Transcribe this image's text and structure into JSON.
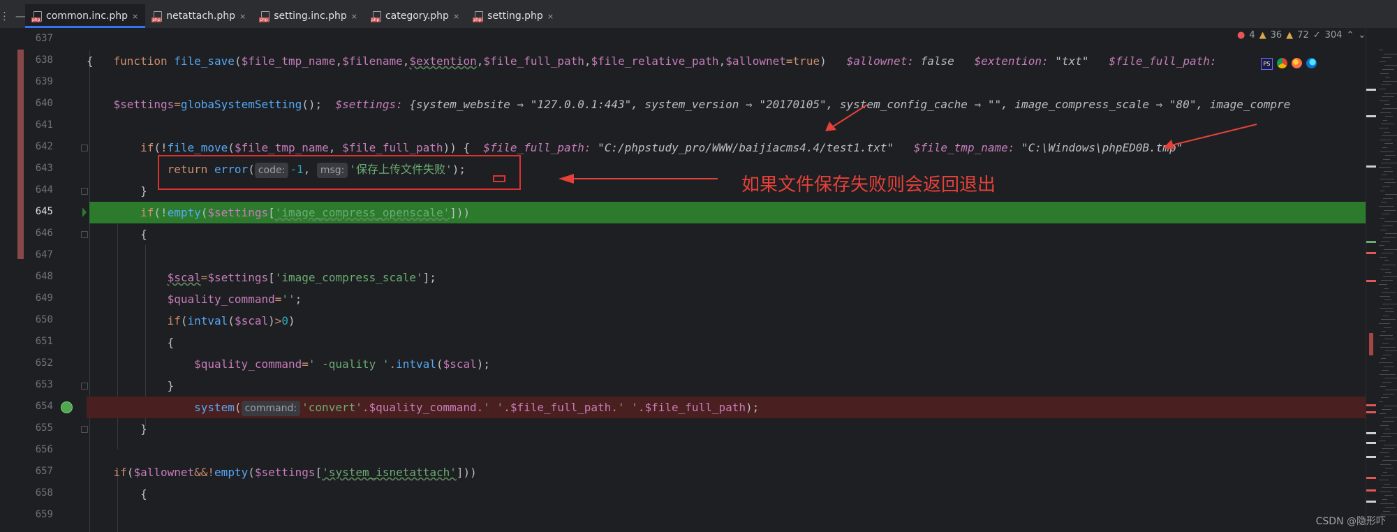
{
  "tabs": [
    {
      "label": "common.inc.php",
      "active": true
    },
    {
      "label": "netattach.php",
      "active": false
    },
    {
      "label": "setting.inc.php",
      "active": false
    },
    {
      "label": "category.php",
      "active": false
    },
    {
      "label": "setting.php",
      "active": false
    }
  ],
  "tab_close_glyph": "×",
  "line_numbers": [
    "637",
    "638",
    "639",
    "640",
    "641",
    "642",
    "643",
    "644",
    "645",
    "646",
    "647",
    "648",
    "649",
    "650",
    "651",
    "652",
    "653",
    "654",
    "655",
    "656",
    "657",
    "658",
    "659"
  ],
  "current_line": "645",
  "code": {
    "l637": {
      "kw": "function",
      "fn": "file_save",
      "p1": "$file_tmp_name",
      "p2": "$filename",
      "p3": "$extention",
      "p4": "$file_full_path",
      "p5": "$file_relative_path",
      "p6": "$allownet",
      "def": "true",
      "dbg1k": "$allownet:",
      "dbg1v": "false",
      "dbg2k": "$extention:",
      "dbg2v": "\"txt\"",
      "dbg3k": "$file_full_path:",
      "dbg3v": ""
    },
    "l638": "{",
    "l640": {
      "var": "$settings",
      "fn": "globaSystemSetting",
      "dbgk": "$settings:",
      "dbgv": "{system_website ⇒ \"127.0.0.1:443\", system_version ⇒ \"20170105\", system_config_cache ⇒ \"\", image_compress_scale ⇒ \"80\", image_compre"
    },
    "l642": {
      "kw": "if",
      "fn": "file_move",
      "a1": "$file_tmp_name",
      "a2": "$file_full_path",
      "dbg1k": "$file_full_path:",
      "dbg1v": "\"C:/phpstudy_pro/WWW/baijiacms4.4/test1.txt\"",
      "dbg2k": "$file_tmp_name:",
      "dbg2v": "\"C:\\Windows\\phpED0B.tmp\""
    },
    "l643": {
      "kw": "return",
      "fn": "error",
      "hint1": "code:",
      "num": "-1",
      "hint2": "msg:",
      "str": "'保存上传文件失败'"
    },
    "l644": "}",
    "l645": {
      "kw": "if",
      "fn": "empty",
      "var": "$settings",
      "key": "'image_compress_openscale'"
    },
    "l646": "{",
    "l648": {
      "var": "$scal",
      "var2": "$settings",
      "key": "'image_compress_scale'"
    },
    "l649": {
      "var": "$quality_command",
      "str": "''"
    },
    "l650": {
      "kw": "if",
      "fn": "intval",
      "var": "$scal",
      "num": "0"
    },
    "l651": "{",
    "l652": {
      "var": "$quality_command",
      "str": "' -quality '",
      "fn": "intval",
      "var2": "$scal"
    },
    "l653": "}",
    "l654": {
      "fn": "system",
      "hint": "command:",
      "s1": "'convert'",
      "v1": "$quality_command",
      "s2": "' '",
      "v2": "$file_full_path",
      "s3": "' '",
      "v3": "$file_full_path"
    },
    "l655": "}",
    "l657": {
      "kw": "if",
      "var": "$allownet",
      "fn": "empty",
      "var2": "$settings",
      "key": "'system_isnetattach'"
    },
    "l658": "{"
  },
  "inspections": {
    "errors": "4",
    "warnings1": "36",
    "warnings2": "72",
    "weak": "304"
  },
  "annotation": "如果文件保存失败则会返回退出",
  "watermark": "CSDN @隐形吓",
  "colors": {
    "keyword": "#cf8e6d",
    "function": "#56a8f5",
    "variable": "#c77dbb",
    "string": "#6aab73",
    "number": "#2aacb8",
    "green_line": "#2c7b2c",
    "red_line": "#4a1f1f",
    "annotation": "#e5413a"
  }
}
